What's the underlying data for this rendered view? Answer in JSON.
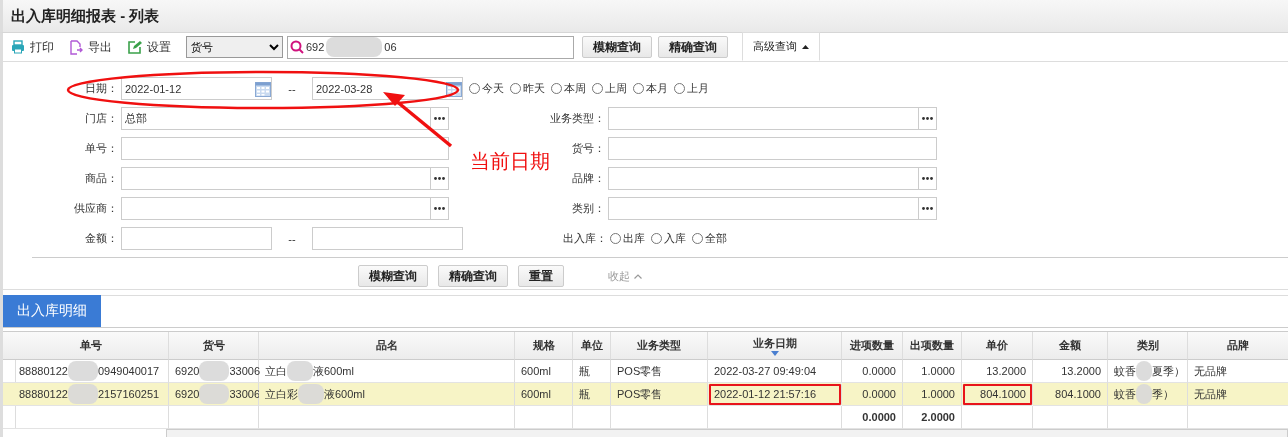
{
  "title": "出入库明细报表 - 列表",
  "toolbar": {
    "actions": [
      {
        "kind": "print",
        "label": "打印"
      },
      {
        "kind": "export",
        "label": "导出"
      },
      {
        "kind": "settings",
        "label": "设置"
      }
    ],
    "field_select": {
      "value": "货号"
    },
    "search": {
      "value_parts": [
        "692",
        "06"
      ]
    },
    "buttons": [
      "模糊查询",
      "精确查询"
    ],
    "advanced_tab": {
      "label": "高级查询",
      "expanded": true
    }
  },
  "filters": {
    "date": {
      "label": "日期：",
      "from": "2022-01-12",
      "separator": "--",
      "to": "2022-03-28",
      "presets": [
        {
          "label": "今天",
          "selected": false
        },
        {
          "label": "昨天",
          "selected": false
        },
        {
          "label": "本周",
          "selected": false
        },
        {
          "label": "上周",
          "selected": false
        },
        {
          "label": "本月",
          "selected": false
        },
        {
          "label": "上月",
          "selected": false
        }
      ]
    },
    "left_fields": [
      {
        "label": "门店：",
        "value": "总部",
        "picker": true
      },
      {
        "label": "单号：",
        "picker": false
      },
      {
        "label": "商品：",
        "picker": true
      },
      {
        "label": "供应商：",
        "picker": true
      }
    ],
    "amount": {
      "label": "金额：",
      "separator": "--"
    },
    "right_fields": [
      {
        "label": "业务类型：",
        "picker": true
      },
      {
        "label": "货号：",
        "picker": false
      },
      {
        "label": "品牌：",
        "picker": true
      },
      {
        "label": "类别：",
        "picker": true
      }
    ],
    "direction": {
      "label": "出入库：",
      "options": [
        {
          "label": "出库",
          "selected": false
        },
        {
          "label": "入库",
          "selected": false
        },
        {
          "label": "全部",
          "selected": false
        }
      ]
    },
    "buttons": [
      "模糊查询",
      "精确查询",
      "重置"
    ],
    "collapse": {
      "label": "收起"
    }
  },
  "annotation": {
    "label": "当前日期"
  },
  "tabs": [
    {
      "label": "出入库明细",
      "selected": true
    }
  ],
  "table": {
    "columns": [
      {
        "label": "单号",
        "kind": "text"
      },
      {
        "label": "货号",
        "kind": "text"
      },
      {
        "label": "品名",
        "kind": "text"
      },
      {
        "label": "规格",
        "kind": "text"
      },
      {
        "label": "单位",
        "kind": "text"
      },
      {
        "label": "业务类型",
        "kind": "text"
      },
      {
        "label": "业务日期",
        "kind": "text",
        "sorted": true
      },
      {
        "label": "进项数量",
        "kind": "number",
        "total": "0.0000"
      },
      {
        "label": "出项数量",
        "kind": "number",
        "total": "2.0000"
      },
      {
        "label": "单价",
        "kind": "number"
      },
      {
        "label": "金额",
        "kind": "number"
      },
      {
        "label": "类别",
        "kind": "text"
      },
      {
        "label": "品牌",
        "kind": "text"
      }
    ],
    "rows": [
      {
        "selected": false,
        "cells": [
          {
            "parts": [
              "88880122",
              "0949040017"
            ]
          },
          {
            "parts": [
              "6920",
              "33006"
            ]
          },
          {
            "parts": [
              "立白",
              "液600ml"
            ]
          },
          {
            "text": "600ml"
          },
          {
            "text": "瓶"
          },
          {
            "text": "POS零售"
          },
          {
            "text": "2022-03-27 09:49:04"
          },
          {
            "text": "0.0000"
          },
          {
            "text": "1.0000"
          },
          {
            "text": "13.2000"
          },
          {
            "text": "13.2000"
          },
          {
            "parts": [
              "蚊香",
              "夏季）"
            ]
          },
          {
            "text": "无品牌"
          }
        ]
      },
      {
        "selected": true,
        "cells": [
          {
            "parts": [
              "88880122",
              "2157160251"
            ]
          },
          {
            "parts": [
              "6920",
              "33006"
            ]
          },
          {
            "parts": [
              "立白彩",
              "液600ml"
            ]
          },
          {
            "text": "600ml"
          },
          {
            "text": "瓶"
          },
          {
            "text": "POS零售"
          },
          {
            "text": "2022-01-12 21:57:16",
            "marked": true
          },
          {
            "text": "0.0000"
          },
          {
            "text": "1.0000"
          },
          {
            "text": "804.1000",
            "marked": true
          },
          {
            "text": "804.1000"
          },
          {
            "parts": [
              "蚊香",
              "季）"
            ]
          },
          {
            "text": "无品牌"
          }
        ]
      }
    ]
  }
}
